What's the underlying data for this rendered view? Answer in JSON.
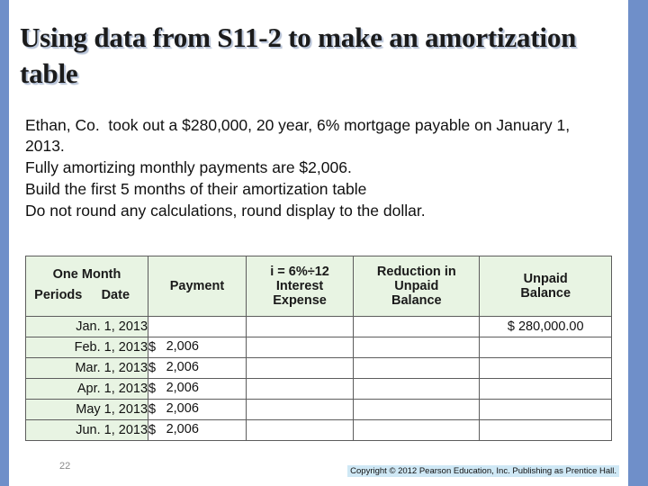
{
  "slide": {
    "title": "Using data from S11-2 to make an amortization table",
    "body_lines": [
      "Ethan, Co.  took out a $280,000, 20 year, 6% mortgage payable on January 1, 2013.",
      "Fully amortizing monthly payments are $2,006.",
      "Build the first 5 months of their amortization table",
      "Do not round any calculations, round display to the dollar."
    ],
    "slide_number": "22",
    "copyright": "Copyright © 2012 Pearson Education, Inc. Publishing as Prentice Hall."
  },
  "table": {
    "headers": {
      "col1_line1": "One Month",
      "col1_line2": "Periods",
      "col1_line3": "Date",
      "col2": "Payment",
      "col3_line1": "i = 6%÷12",
      "col3_line2": "Interest",
      "col3_line3": "Expense",
      "col4_line1": "Reduction in",
      "col4_line2": "Unpaid",
      "col4_line3": "Balance",
      "col5_line1": "Unpaid",
      "col5_line2": "Balance"
    },
    "rows": [
      {
        "date": "Jan. 1, 2013",
        "payment_symbol": "",
        "payment": "",
        "interest": "",
        "reduction": "",
        "balance": "$ 280,000.00"
      },
      {
        "date": "Feb. 1, 2013",
        "payment_symbol": "$",
        "payment": "2,006",
        "interest": "",
        "reduction": "",
        "balance": ""
      },
      {
        "date": "Mar. 1, 2013",
        "payment_symbol": "$",
        "payment": "2,006",
        "interest": "",
        "reduction": "",
        "balance": ""
      },
      {
        "date": "Apr. 1, 2013",
        "payment_symbol": "$",
        "payment": "2,006",
        "interest": "",
        "reduction": "",
        "balance": ""
      },
      {
        "date": "May 1, 2013",
        "payment_symbol": "$",
        "payment": "2,006",
        "interest": "",
        "reduction": "",
        "balance": ""
      },
      {
        "date": "Jun. 1, 2013",
        "payment_symbol": "$",
        "payment": "2,006",
        "interest": "",
        "reduction": "",
        "balance": ""
      }
    ]
  },
  "theme": {
    "accent_bar_color": "#6f8fc9",
    "table_header_bg": "#e8f4e3",
    "copyright_bg": "#cfe8f5"
  }
}
